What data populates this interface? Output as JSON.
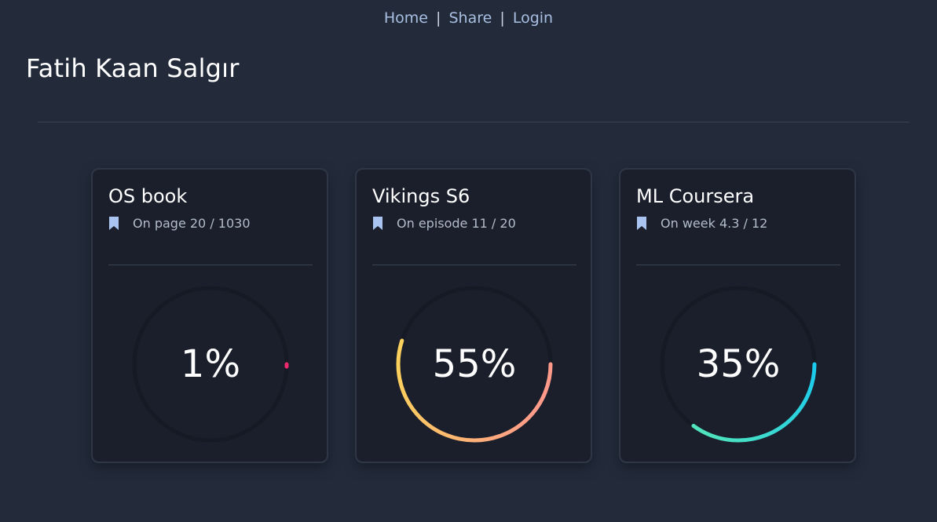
{
  "nav": {
    "home": "Home",
    "share": "Share",
    "login": "Login",
    "separator": "|"
  },
  "page": {
    "title": "Fatih Kaan Salgır"
  },
  "cards": [
    {
      "title": "OS book",
      "status": "On page 20 / 1030",
      "percent_label": "1%",
      "progress": 0.01,
      "gradient": [
        "#ff4d8d",
        "#e91e63"
      ]
    },
    {
      "title": "Vikings S6",
      "status": "On episode 11 / 20",
      "percent_label": "55%",
      "progress": 0.55,
      "gradient": [
        "#ff9a8b",
        "#fcd25b"
      ]
    },
    {
      "title": "ML Coursera",
      "status": "On week 4.3 / 12",
      "percent_label": "35%",
      "progress": 0.35,
      "gradient": [
        "#17c8f0",
        "#55e6b8"
      ]
    }
  ],
  "colors": {
    "background": "#232b3b",
    "card": "#1a1f2b",
    "track": "#151a24",
    "bookmark": "#a9c4f0"
  }
}
